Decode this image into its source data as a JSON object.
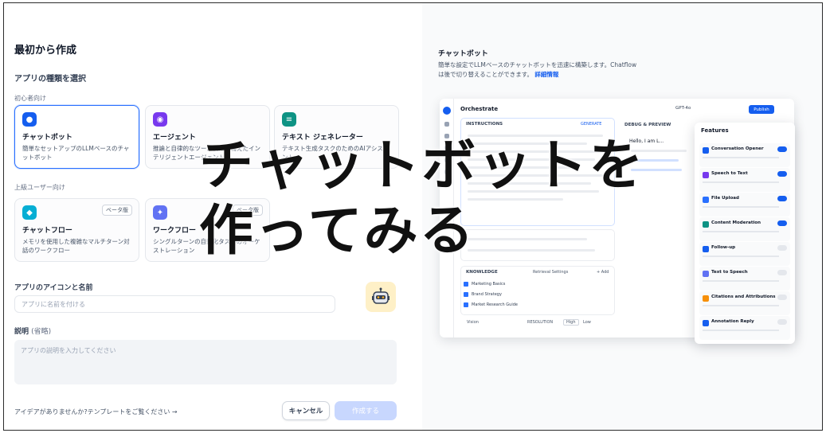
{
  "left": {
    "title": "最初から作成",
    "app_type_title": "アプリの種類を選択",
    "beginner_label": "初心者向け",
    "advanced_label": "上級ユーザー向け",
    "cards_beginner": [
      {
        "name": "チャットボット",
        "desc": "簡単なセットアップのLLMベースのチャットボット",
        "color": "#155eef"
      },
      {
        "name": "エージェント",
        "desc": "推論と自律的なツール使用を備えたインテリジェントエージェント",
        "color": "#7839ee"
      },
      {
        "name": "テキスト ジェネレーター",
        "desc": "テキスト生成タスクのためのAIアシスタント",
        "color": "#0e9384"
      }
    ],
    "cards_advanced": [
      {
        "name": "チャットフロー",
        "desc": "メモリを使用した複雑なマルチターン対話のワークフロー",
        "badge": "ベータ版",
        "color": "#06aed4"
      },
      {
        "name": "ワークフロー",
        "desc": "シングルターンの自動化タスクのオーケストレーション",
        "badge": "ベータ版",
        "color": "#6172f3"
      }
    ],
    "icon_name_label": "アプリのアイコンと名前",
    "name_placeholder": "アプリに名前を付ける",
    "desc_label": "説明",
    "desc_optional": "(省略)",
    "desc_placeholder": "アプリの説明を入力してください",
    "template_link": "アイデアがありませんか?テンプレートをご覧ください →",
    "cancel_label": "キャンセル",
    "create_label": "作成する"
  },
  "right": {
    "title": "チャットボット",
    "desc": "簡単な設定でLLMベースのチャットボットを迅速に構築します。Chatflowは後で切り替えることができます。",
    "link": "詳細情報",
    "preview": {
      "app_name": "Orchestrate",
      "model": "GPT-4o",
      "publish": "Publish",
      "instructions": "INSTRUCTIONS",
      "debug": "DEBUG & PREVIEW",
      "generate": "GENERATE",
      "knowledge": "KNOWLEDGE",
      "add": "+ Add",
      "retrieval": "Retrieval Settings",
      "knowledge_items": [
        "Marketing Basics",
        "Brand Strategy",
        "Market Research Guide"
      ],
      "vision": "Vision",
      "resolution": "RESOLUTION",
      "high": "High",
      "low": "Low",
      "hello": "Hello, I am L..."
    },
    "features": {
      "title": "Features",
      "items": [
        {
          "name": "Conversation Opener",
          "on": true,
          "color": "#155eef"
        },
        {
          "name": "Speech to Text",
          "on": true,
          "color": "#7839ee"
        },
        {
          "name": "File Upload",
          "on": true,
          "color": "#2970ff"
        },
        {
          "name": "Content Moderation",
          "on": true,
          "color": "#0e9384"
        },
        {
          "name": "Follow-up",
          "on": false,
          "color": "#155eef"
        },
        {
          "name": "Text to Speech",
          "on": false,
          "color": "#6172f3"
        },
        {
          "name": "Citations and Attributions",
          "on": false,
          "color": "#f79009"
        },
        {
          "name": "Annotation Reply",
          "on": false,
          "color": "#155eef"
        }
      ]
    }
  },
  "caption": {
    "line1": "チャットボットを",
    "line2": "作ってみる"
  }
}
